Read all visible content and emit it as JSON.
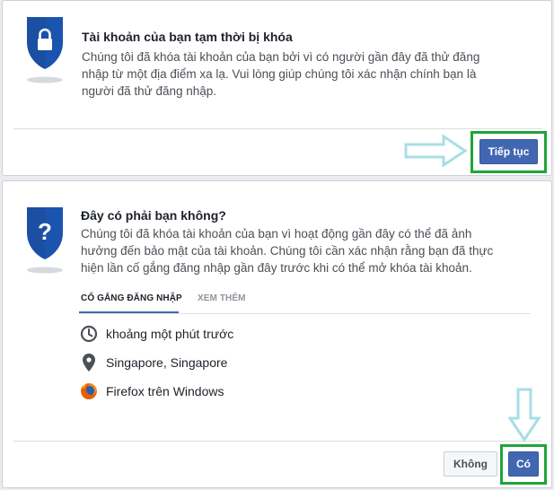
{
  "locked_card": {
    "icon": "lock-shield-icon",
    "title": "Tài khoản của bạn tạm thời bị khóa",
    "description_lines": [
      "Chúng tôi đã khóa tài khoản của bạn bởi vì có người gần đây đã thử đăng",
      "nhập từ một địa điểm xa lạ. Vui lòng giúp chúng tôi xác nhận chính bạn là",
      "người đã thử đăng nhập."
    ],
    "continue_label": "Tiếp tục"
  },
  "verify_card": {
    "icon": "question-shield-icon",
    "title": "Đây có phải bạn không?",
    "description_lines": [
      "Chúng tôi đã khóa tài khoản của bạn vì hoạt động gần đây có thể đã ảnh",
      "hưởng đến bảo mật của tài khoản. Chúng tôi cần xác nhận rằng bạn đã thực",
      "hiện lần cố gắng đăng nhập gần đây trước khi có thể mở khóa tài khoản."
    ],
    "tabs": [
      {
        "label": "CỐ GẮNG ĐĂNG NHẬP",
        "active": true
      },
      {
        "label": "XEM THÊM",
        "active": false
      }
    ],
    "details": [
      {
        "icon": "clock-icon",
        "text": "khoảng một phút trước"
      },
      {
        "icon": "location-pin-icon",
        "text": "Singapore, Singapore"
      },
      {
        "icon": "firefox-icon",
        "text": "Firefox trên Windows"
      }
    ],
    "no_label": "Không",
    "yes_label": "Có"
  },
  "colors": {
    "accent": "#4267b2",
    "highlight": "#1ea539",
    "arrow": "#a9dde6",
    "shield": "#1b4fa3"
  }
}
